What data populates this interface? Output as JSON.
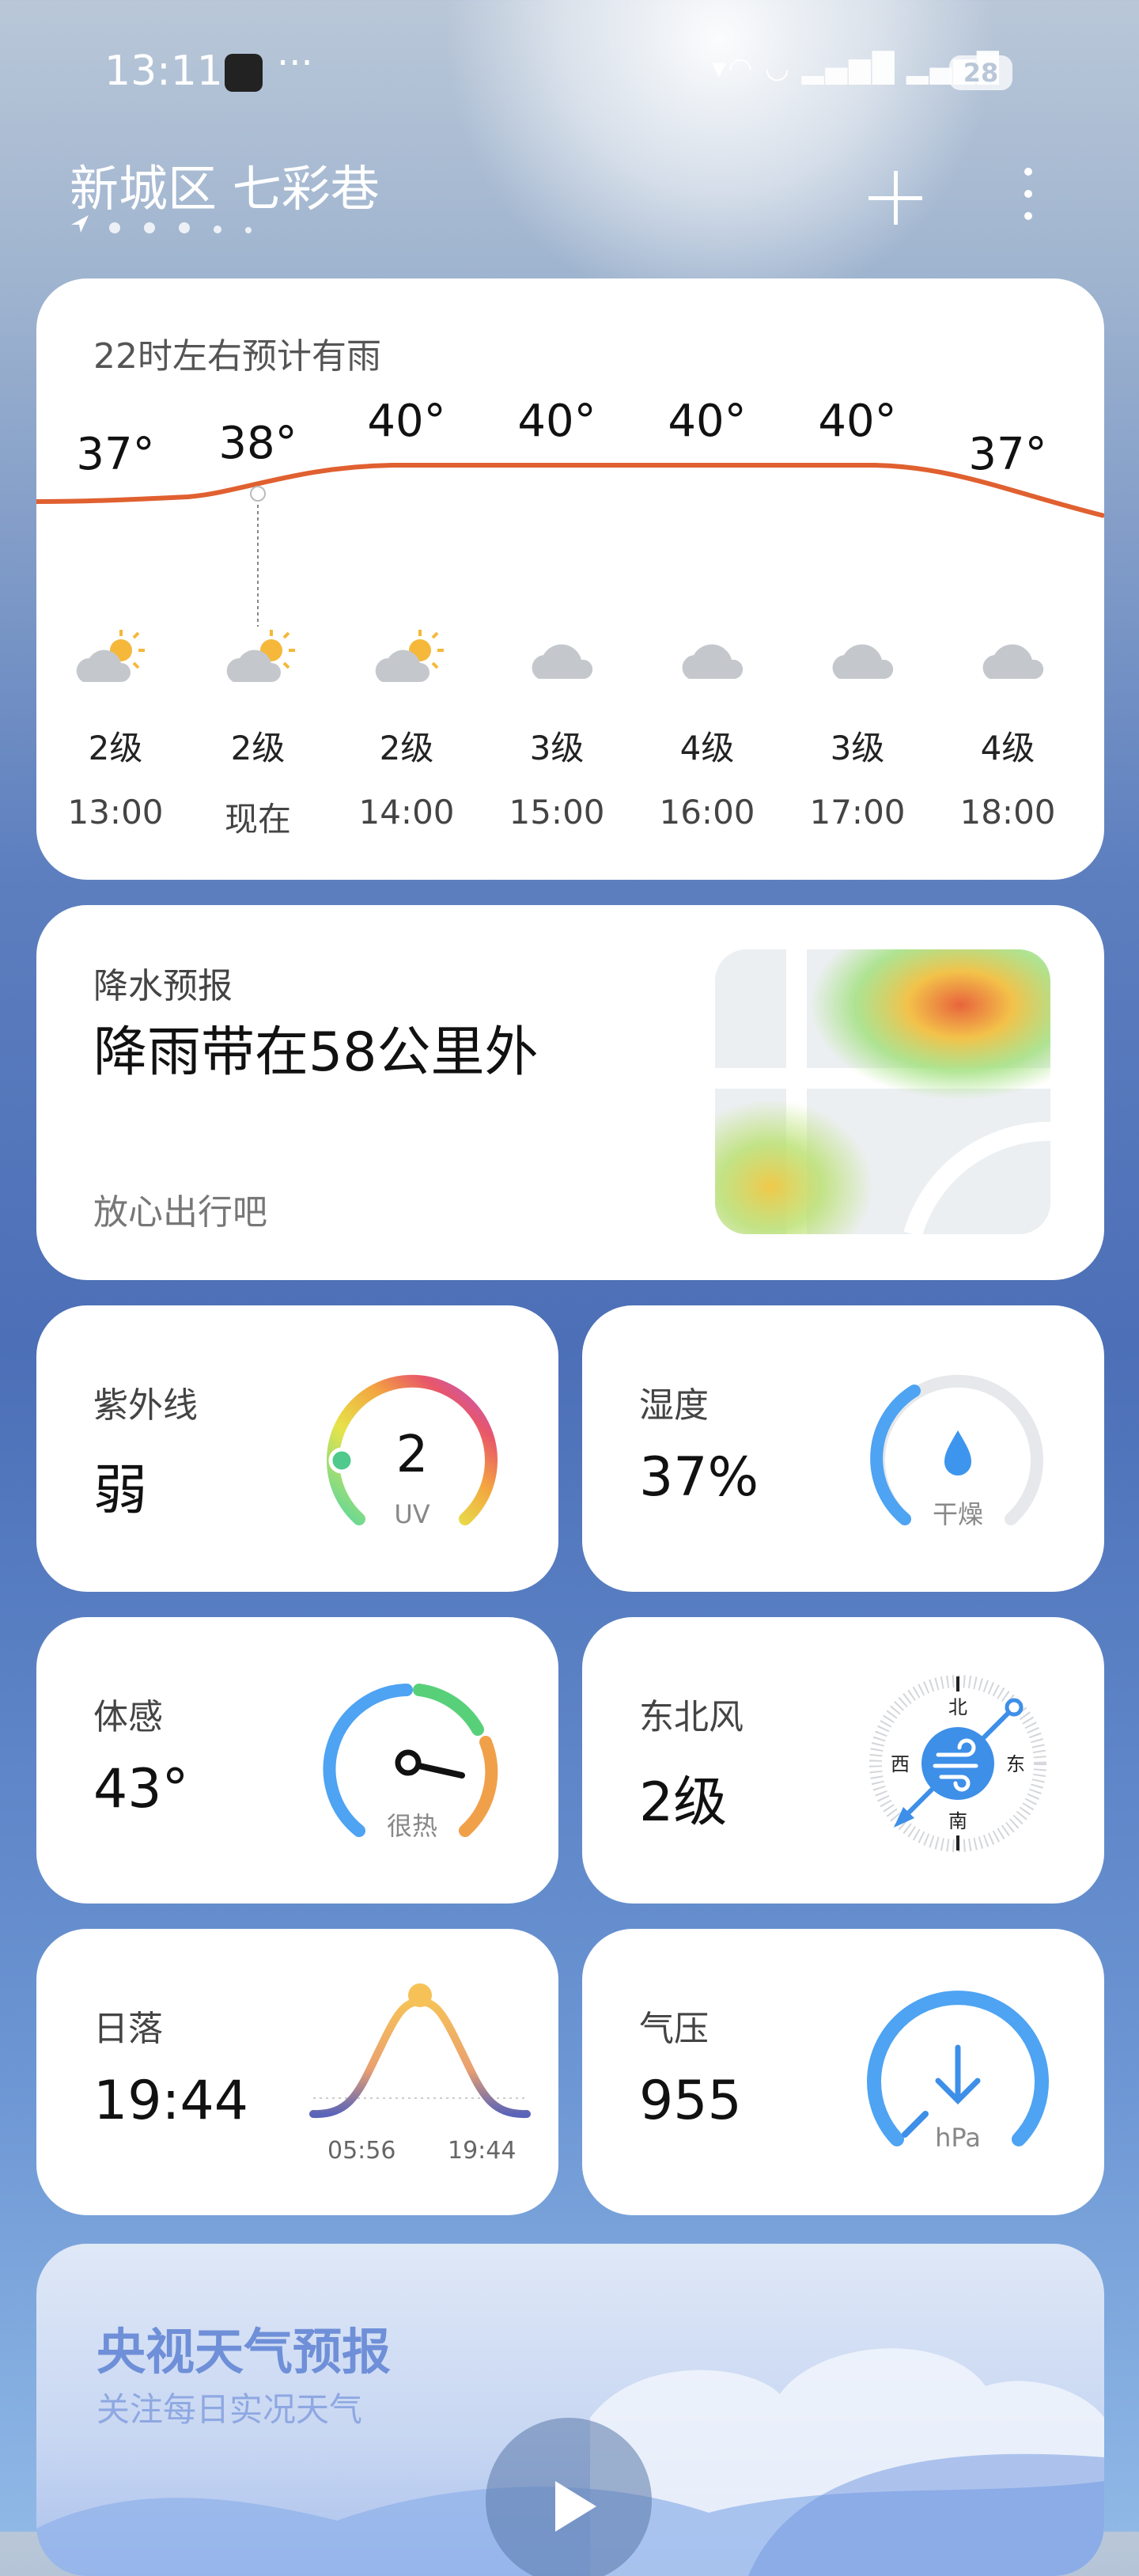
{
  "status_bar": {
    "time": "13:11",
    "dots": "···",
    "network": "▾◠  ◡ ▂▄▆█ ▂▄▆█",
    "battery": "28"
  },
  "header": {
    "location": "新城区 七彩巷",
    "add_icon": "plus-icon",
    "more_icon": "more-vertical-icon"
  },
  "hourly": {
    "note": "22时左右预计有雨",
    "hours": [
      {
        "temp": "37°",
        "icon": "partly-cloudy-day",
        "wind": "2级",
        "time": "13:00"
      },
      {
        "temp": "38°",
        "icon": "partly-cloudy-day",
        "wind": "2级",
        "time": "现在"
      },
      {
        "temp": "40°",
        "icon": "partly-cloudy-day",
        "wind": "2级",
        "time": "14:00"
      },
      {
        "temp": "40°",
        "icon": "cloudy",
        "wind": "3级",
        "time": "15:00"
      },
      {
        "temp": "40°",
        "icon": "cloudy",
        "wind": "4级",
        "time": "16:00"
      },
      {
        "temp": "40°",
        "icon": "cloudy",
        "wind": "3级",
        "time": "17:00"
      },
      {
        "temp": "37°",
        "icon": "cloudy",
        "wind": "4级",
        "time": "18:00"
      }
    ],
    "curve_color": "#e06030"
  },
  "precipitation": {
    "title": "降水预报",
    "main": "降雨带在58公里外",
    "sub": "放心出行吧"
  },
  "uv": {
    "label": "紫外线",
    "value": "弱",
    "index": "2",
    "unit": "UV"
  },
  "humidity": {
    "label": "湿度",
    "value": "37%",
    "desc": "干燥",
    "percent": 37
  },
  "feels": {
    "label": "体感",
    "value": "43°",
    "desc": "很热"
  },
  "wind": {
    "label": "东北风",
    "value": "2级",
    "north": "北",
    "south": "南",
    "west": "西",
    "east": "东"
  },
  "sunset": {
    "label": "日落",
    "value": "19:44",
    "sunrise_time": "05:56",
    "sunset_time": "19:44"
  },
  "pressure": {
    "label": "气压",
    "value": "955",
    "unit": "hPa"
  },
  "video": {
    "title": "央视天气预报",
    "subtitle": "关注每日实况天气"
  }
}
